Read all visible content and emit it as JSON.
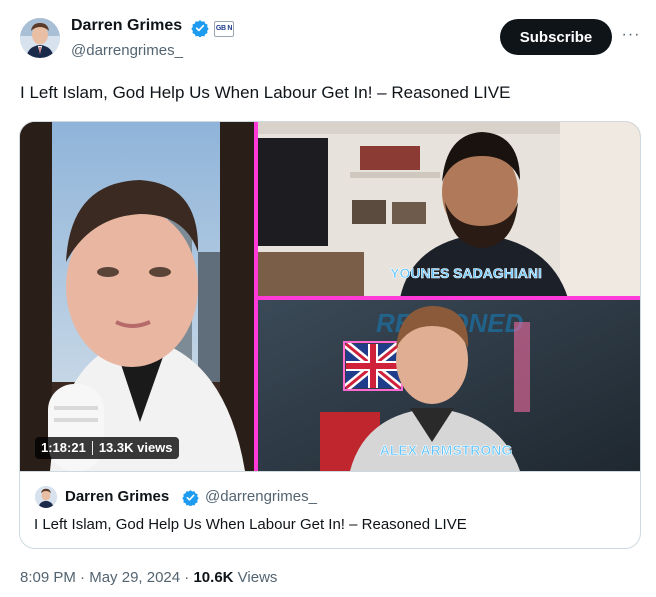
{
  "author": {
    "name": "Darren Grimes",
    "handle": "@darrengrimes_",
    "affiliation_badge": "GB News"
  },
  "actions": {
    "subscribe_label": "Subscribe",
    "more_label": "···"
  },
  "tweet": {
    "text": "I Left Islam, God Help Us When Labour Get In! – Reasoned LIVE"
  },
  "video": {
    "duration": "1:18:21",
    "views": "13.3K views",
    "overlay_labels": {
      "top_guest": "YOUNES SADAGHIANI",
      "bottom_guest": "ALEX ARMSTRONG",
      "show_sign": "REASONED"
    }
  },
  "quoted": {
    "name": "Darren Grimes",
    "handle": "@darrengrimes_",
    "text": "I Left Islam, God Help Us When Labour Get In! – Reasoned LIVE"
  },
  "footer": {
    "time": "8:09 PM",
    "date": "May 29, 2024",
    "view_count": "10.6K",
    "views_label": "Views"
  },
  "colors": {
    "verified_blue": "#1d9bf0",
    "neon_border": "#ff3ad8",
    "label_blue": "#5fc4ff",
    "text_primary": "#0f1419",
    "text_secondary": "#536471"
  }
}
